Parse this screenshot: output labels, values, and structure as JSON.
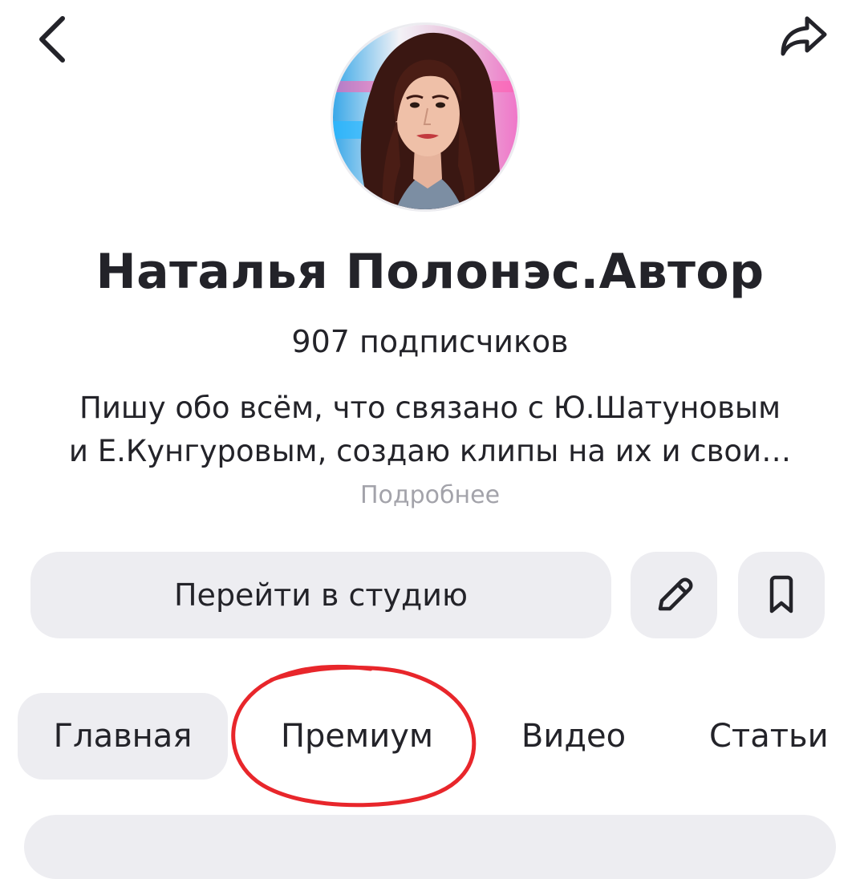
{
  "header": {
    "back_icon": "chevron-left-icon",
    "share_icon": "share-arrow-icon"
  },
  "profile": {
    "name": "Наталья Полонэс.Автор",
    "subscribers": "907 подписчиков",
    "description_line1": "Пишу  обо всём, что связано с Ю.Шатуновым",
    "description_line2": "и Е.Кунгуровым, создаю клипы на их и свои…",
    "more_link": "Подробнее"
  },
  "actions": {
    "studio_label": "Перейти в студию",
    "edit_icon": "pencil-icon",
    "bookmark_icon": "bookmark-icon"
  },
  "tabs": [
    {
      "label": "Главная",
      "active": true
    },
    {
      "label": "Премиум",
      "active": false
    },
    {
      "label": "Видео",
      "active": false
    },
    {
      "label": "Статьи",
      "active": false
    }
  ],
  "colors": {
    "text": "#232329",
    "muted": "#a3a3aa",
    "button_bg": "#ededf1",
    "annotation": "#e8262b"
  }
}
